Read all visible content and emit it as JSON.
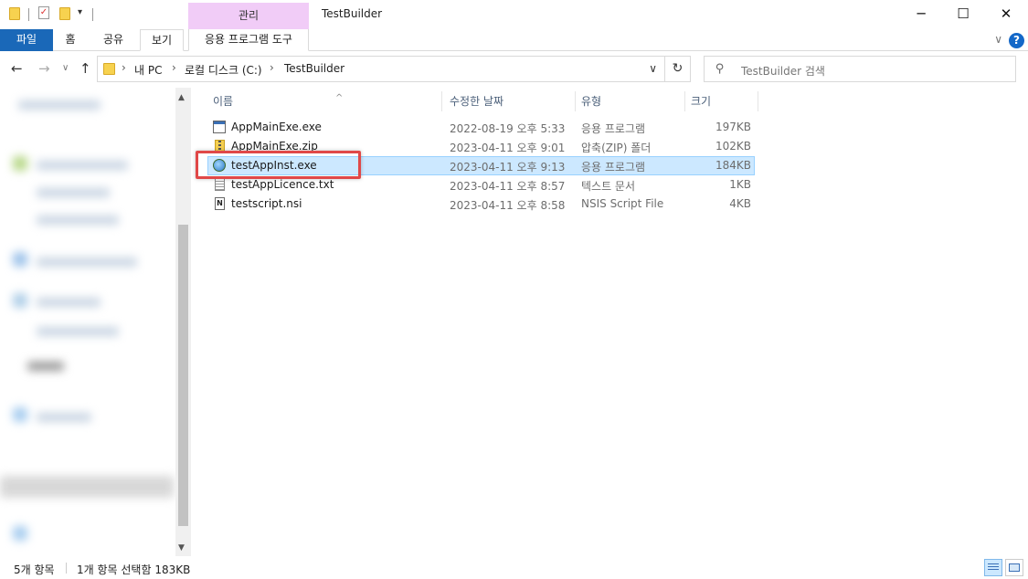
{
  "window": {
    "title": "TestBuilder",
    "context_tab": "관리",
    "minimize": "─",
    "maximize": "☐",
    "close": "✕"
  },
  "ribbon": {
    "tabs": [
      "파일",
      "홈",
      "공유",
      "보기",
      "응용 프로그램 도구"
    ],
    "collapse": "∨",
    "help": "?"
  },
  "nav": {
    "back": "←",
    "forward": "→",
    "recent": "∨",
    "up": "↑",
    "breadcrumb": [
      "내 PC",
      "로컬 디스크 (C:)",
      "TestBuilder"
    ],
    "crumb_sep": "›",
    "address_dropdown": "∨",
    "refresh": "↻",
    "search_placeholder": "TestBuilder 검색",
    "search_icon": "⚲"
  },
  "columns": {
    "name": "이름",
    "date": "수정한 날짜",
    "type": "유형",
    "size": "크기",
    "sort_indicator": "^"
  },
  "files": [
    {
      "name": "AppMainExe.exe",
      "date": "2022-08-19 오후 5:33",
      "type": "응용 프로그램",
      "size": "197KB",
      "icon": "exe-window-icon"
    },
    {
      "name": "AppMainExe.zip",
      "date": "2023-04-11 오후 9:01",
      "type": "압축(ZIP) 폴더",
      "size": "102KB",
      "icon": "zip-folder-icon"
    },
    {
      "name": "testAppInst.exe",
      "date": "2023-04-11 오후 9:13",
      "type": "응용 프로그램",
      "size": "184KB",
      "icon": "installer-icon",
      "selected": true
    },
    {
      "name": "testAppLicence.txt",
      "date": "2023-04-11 오후 8:57",
      "type": "텍스트 문서",
      "size": "1KB",
      "icon": "text-file-icon"
    },
    {
      "name": "testscript.nsi",
      "date": "2023-04-11 오후 8:58",
      "type": "NSIS Script File",
      "size": "4KB",
      "icon": "nsi-script-icon"
    }
  ],
  "statusbar": {
    "item_count": "5개 항목",
    "selection": "1개 항목 선택함 183KB"
  },
  "colors": {
    "file_tab": "#1a68b8",
    "context_tab": "#f1ccf7",
    "selection": "#cce8ff",
    "highlight": "#e04848"
  }
}
